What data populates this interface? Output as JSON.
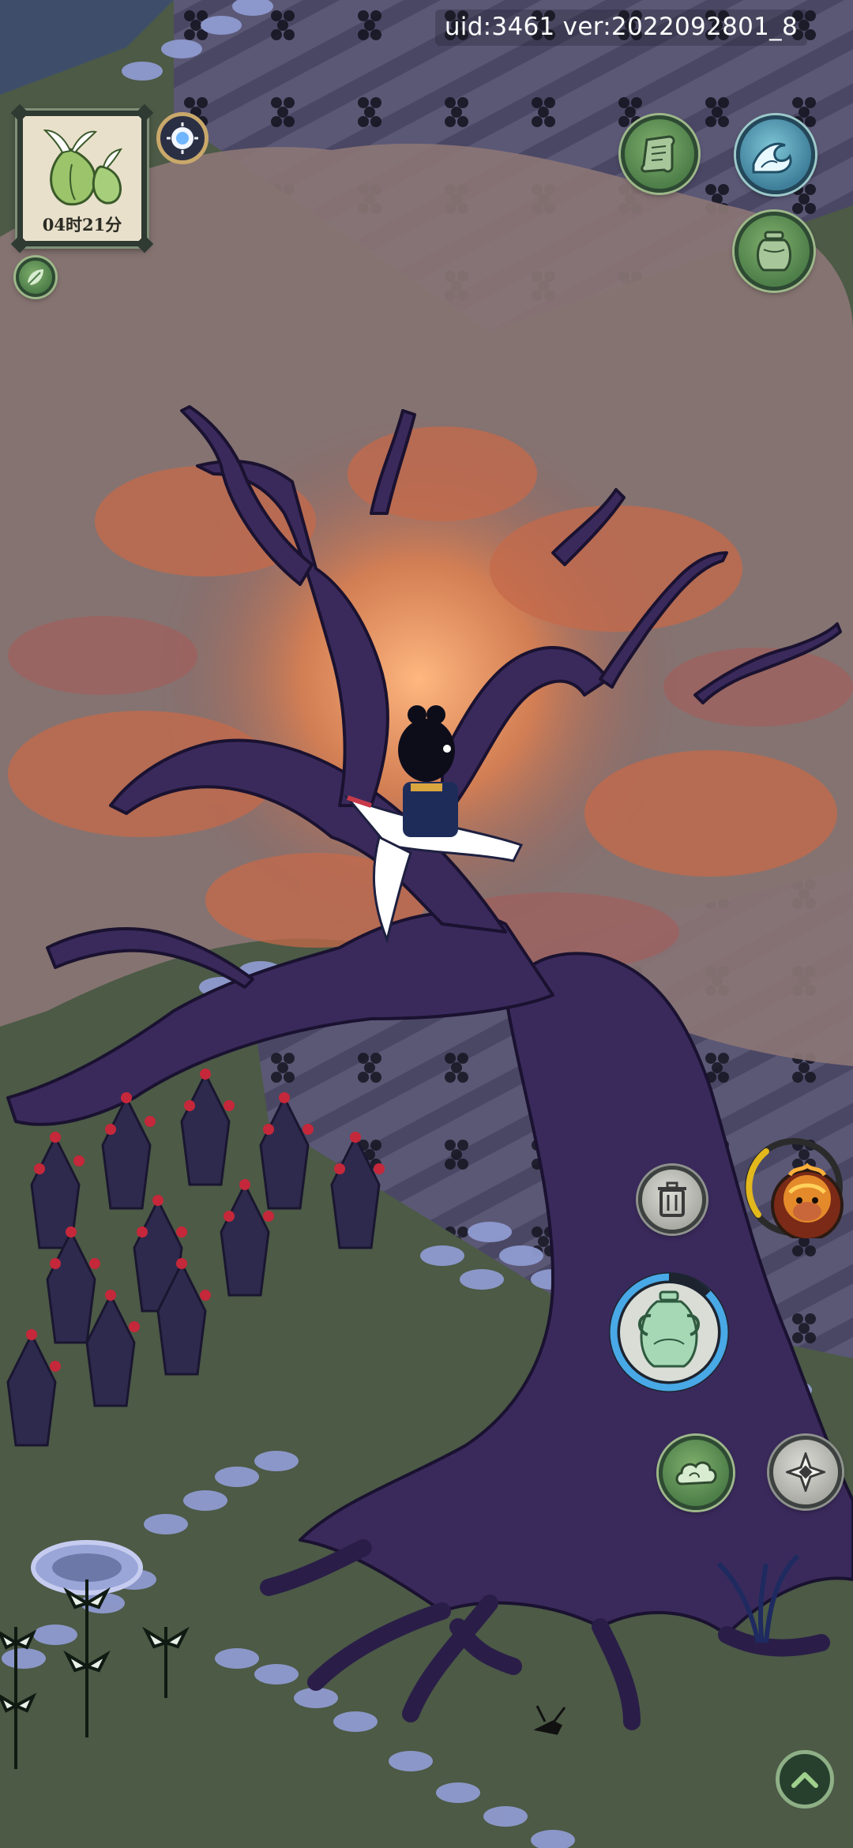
{
  "status": {
    "uid_version": "uid:3461 ver:2022092801_8"
  },
  "crop_timer": {
    "remaining": "04时21分"
  },
  "colors": {
    "grass": "#4c5a46",
    "path_stone": "#8f9bd0",
    "tree_bark": "#3a2a5c",
    "canopy": "#c56a4a",
    "button_green": "#5f8f57",
    "cooldown_ring": "#49a8e6",
    "energy_ring": "#e2b81c"
  },
  "icons": {
    "crop_card": "bulb-sprout-icon",
    "time_of_day": "moon-sun-icon",
    "leaf_button": "leaf-icon",
    "scroll_button": "scroll-icon",
    "wave_button": "wave-icon",
    "jar_button": "jar-icon",
    "trash_button": "trash-icon",
    "character_avatar": "monkey-king-avatar-icon",
    "vase_button": "celadon-vase-icon",
    "cloud_button": "cloud-icon",
    "shuriken_button": "shuriken-icon",
    "collapse_button": "chevron-up-icon"
  }
}
